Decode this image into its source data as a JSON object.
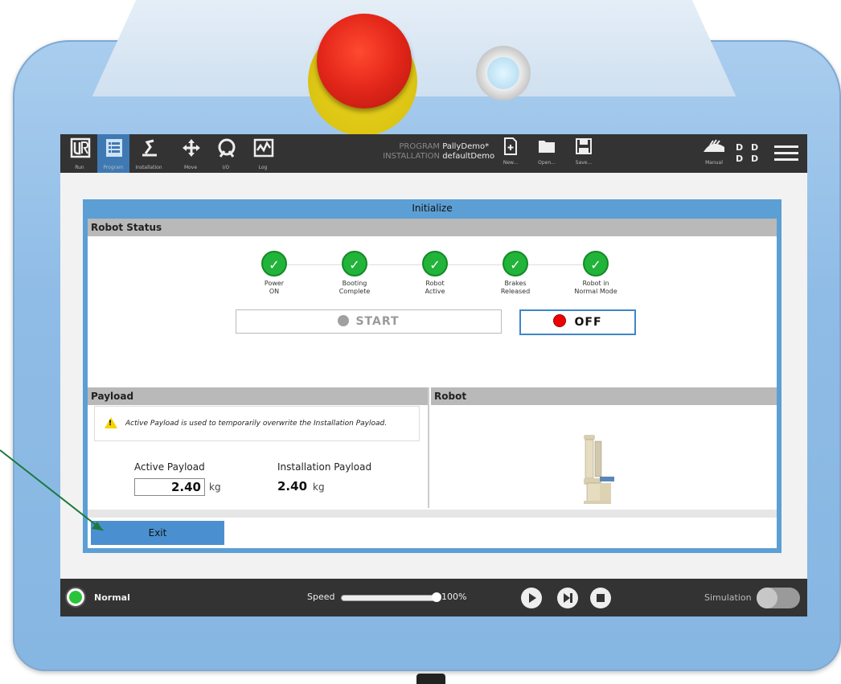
{
  "toolbar": {
    "nav": [
      {
        "label": "Run"
      },
      {
        "label": "Program"
      },
      {
        "label": "Installation"
      },
      {
        "label": "Move"
      },
      {
        "label": "I/O"
      },
      {
        "label": "Log"
      }
    ],
    "program_key": "PROGRAM",
    "program_name": "PallyDemo*",
    "installation_key": "INSTALLATION",
    "installation_name": "defaultDemo",
    "new_label": "New...",
    "open_label": "Open...",
    "save_label": "Save...",
    "mode_label": "Manual",
    "dd_top": "D D",
    "dd_bottom": "D D"
  },
  "dialog": {
    "title": "Initialize",
    "robot_status_header": "Robot Status",
    "steps": [
      {
        "line1": "Power",
        "line2": "ON"
      },
      {
        "line1": "Booting",
        "line2": "Complete"
      },
      {
        "line1": "Robot",
        "line2": "Active"
      },
      {
        "line1": "Brakes",
        "line2": "Released"
      },
      {
        "line1": "Robot in",
        "line2": "Normal Mode"
      }
    ],
    "start_label": "START",
    "off_label": "OFF",
    "payload_header": "Payload",
    "robot_header": "Robot",
    "warning_text": "Active Payload is used to temporarily overwrite the Installation Payload.",
    "active_payload_label": "Active Payload",
    "active_payload_value": "2.40",
    "installation_payload_label": "Installation Payload",
    "installation_payload_value": "2.40",
    "unit": "kg",
    "exit_label": "Exit"
  },
  "footer": {
    "status": "Normal",
    "speed_label": "Speed",
    "speed_value": "100%",
    "speed_fraction": 1.0,
    "simulation_label": "Simulation"
  },
  "colors": {
    "accent": "#5c9fd5",
    "status_green": "#22b33a",
    "stop_red": "#e00000",
    "topbar": "#333333"
  }
}
